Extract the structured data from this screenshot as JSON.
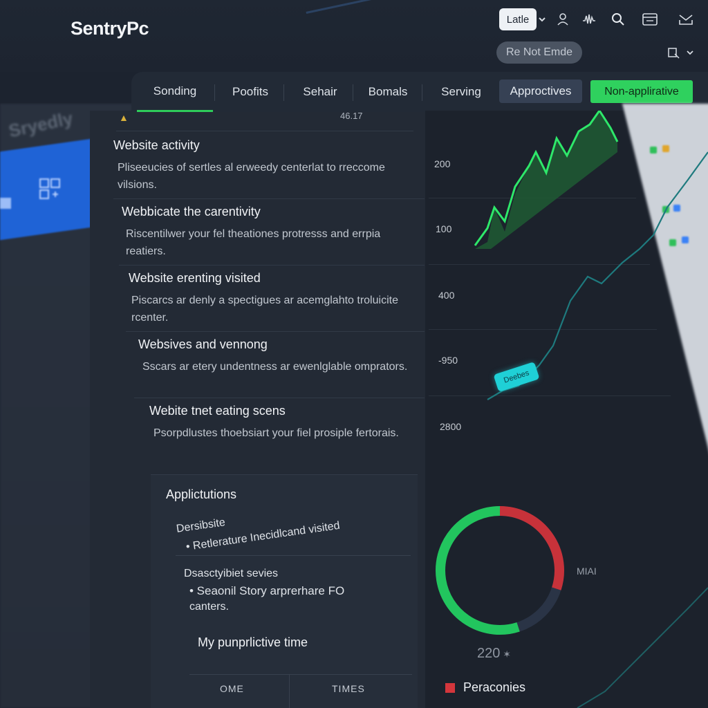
{
  "header": {
    "brand": "SentryPc",
    "lang_button": "Latle",
    "status_pill": "Re Not Emde",
    "icons": [
      "chevron-down-icon",
      "user-icon",
      "activity-icon",
      "search-icon",
      "window-icon",
      "inbox-icon",
      "translate-icon"
    ]
  },
  "tabs": [
    {
      "label": "Sonding",
      "active": true
    },
    {
      "label": "Poofits"
    },
    {
      "label": "Sehair"
    },
    {
      "label": "Bomals"
    },
    {
      "label": "Serving"
    },
    {
      "label": "Approctives"
    },
    {
      "label": "Non-applirative"
    }
  ],
  "sidebar": {
    "ghost_text": "Sryedly"
  },
  "list": {
    "top_number": "46.17",
    "items": [
      {
        "title": "Website activity",
        "desc": "Pliseeucies of sertles al erweedy centerlat to rreccome vilsions."
      },
      {
        "title": "Webbicate the carentivity",
        "desc": "Riscentilwer your fel theationes protresss and errpia reatiers."
      },
      {
        "title": "Website erenting visited",
        "desc": "Piscarcs ar denly a spectigues ar acemglahto troluicite rcenter."
      },
      {
        "title": "Websives and vennong",
        "desc": "Sscars ar etery undentness ar ewenlglable omprators."
      },
      {
        "title": "Webite tnet eating scens",
        "desc": "Psorpdlustes thoebsiart your fiel prosiple fertorais."
      }
    ]
  },
  "applications": {
    "heading": "Applictutions",
    "sub1": "Dersibsite",
    "bullet1": "• Retlerature Inecidlcand visited",
    "sub2": "Dsasctyibiet sevies",
    "bullet2": "• Seaonil Story arprerhare FO",
    "bullet2_cont": "canters.",
    "my_time": "My punprlictive time",
    "table_headers": [
      "OME",
      "TIMES"
    ]
  },
  "chart": {
    "y_ticks": [
      "200",
      "100",
      "400",
      "-950",
      "2800"
    ],
    "tooltip": "Deebes",
    "donut_value": "220",
    "donut_side_label": "MIAI",
    "legend_label": "Peraconies",
    "colors": {
      "green": "#22c55e",
      "red": "#d4363c",
      "dark": "#2a3446",
      "line": "#1e7a7e",
      "tooltip": "#1fd0d6"
    }
  },
  "chart_data": {
    "type": "pie",
    "categories": [
      "",
      "",
      ""
    ],
    "values": [
      55,
      30,
      15
    ],
    "title": "",
    "colors": [
      "#22c55e",
      "#c7323a",
      "#2a3446"
    ]
  }
}
